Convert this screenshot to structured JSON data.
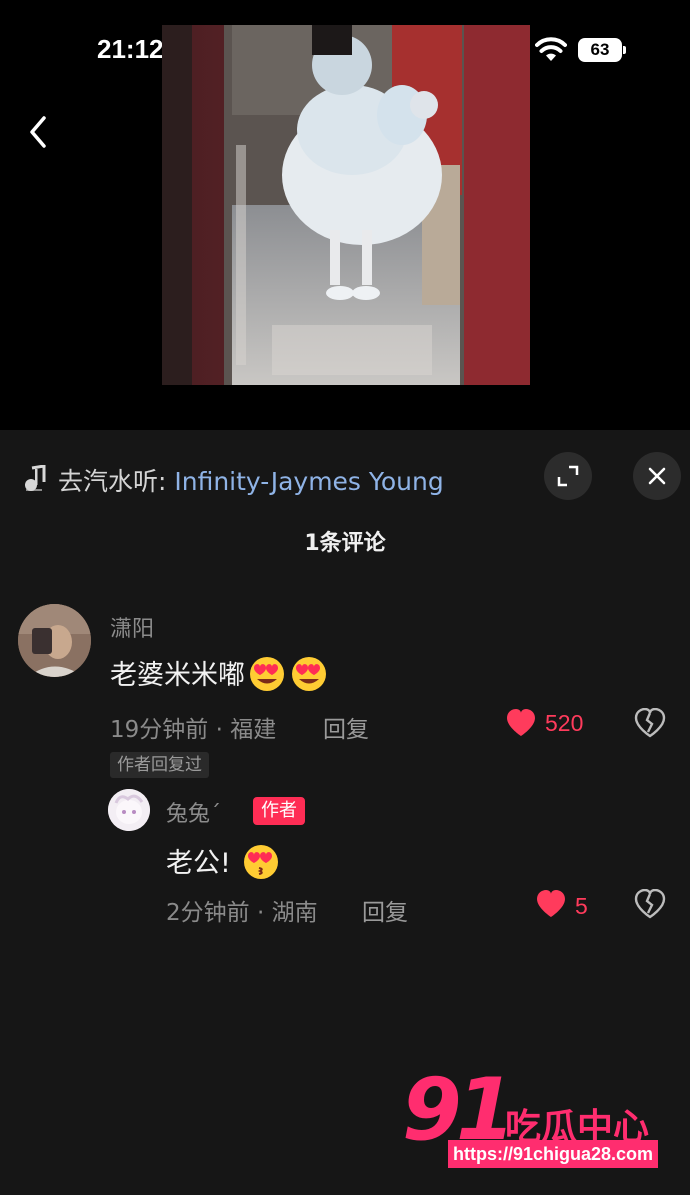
{
  "status_bar": {
    "time": "21:12",
    "battery": "63"
  },
  "music": {
    "prefix": "去汽水听: ",
    "track": "Infinity-Jaymes Young"
  },
  "comments_title": "1条评论",
  "comments": [
    {
      "username": "潇阳",
      "text": "老婆米米嘟",
      "emojis": [
        "heart-eyes-emoji",
        "heart-eyes-emoji"
      ],
      "time_location": "19分钟前 · 福建",
      "reply_label": "回复",
      "likes": "520",
      "author_replied_tag": "作者回复过",
      "replies": [
        {
          "username": "兔兔ˊ",
          "badge": "作者",
          "text": "老公!",
          "emojis": [
            "kissing-heart-emoji"
          ],
          "time_location": "2分钟前 · 湖南",
          "reply_label": "回复",
          "likes": "5"
        }
      ]
    }
  ],
  "watermark": {
    "number": "91",
    "name": "吃瓜中心",
    "url": "https://91chigua28.com"
  },
  "colors": {
    "accent": "#ff2d55",
    "like": "#ff3b5c",
    "link": "#8fb3e6",
    "sheet_bg": "#161616"
  }
}
